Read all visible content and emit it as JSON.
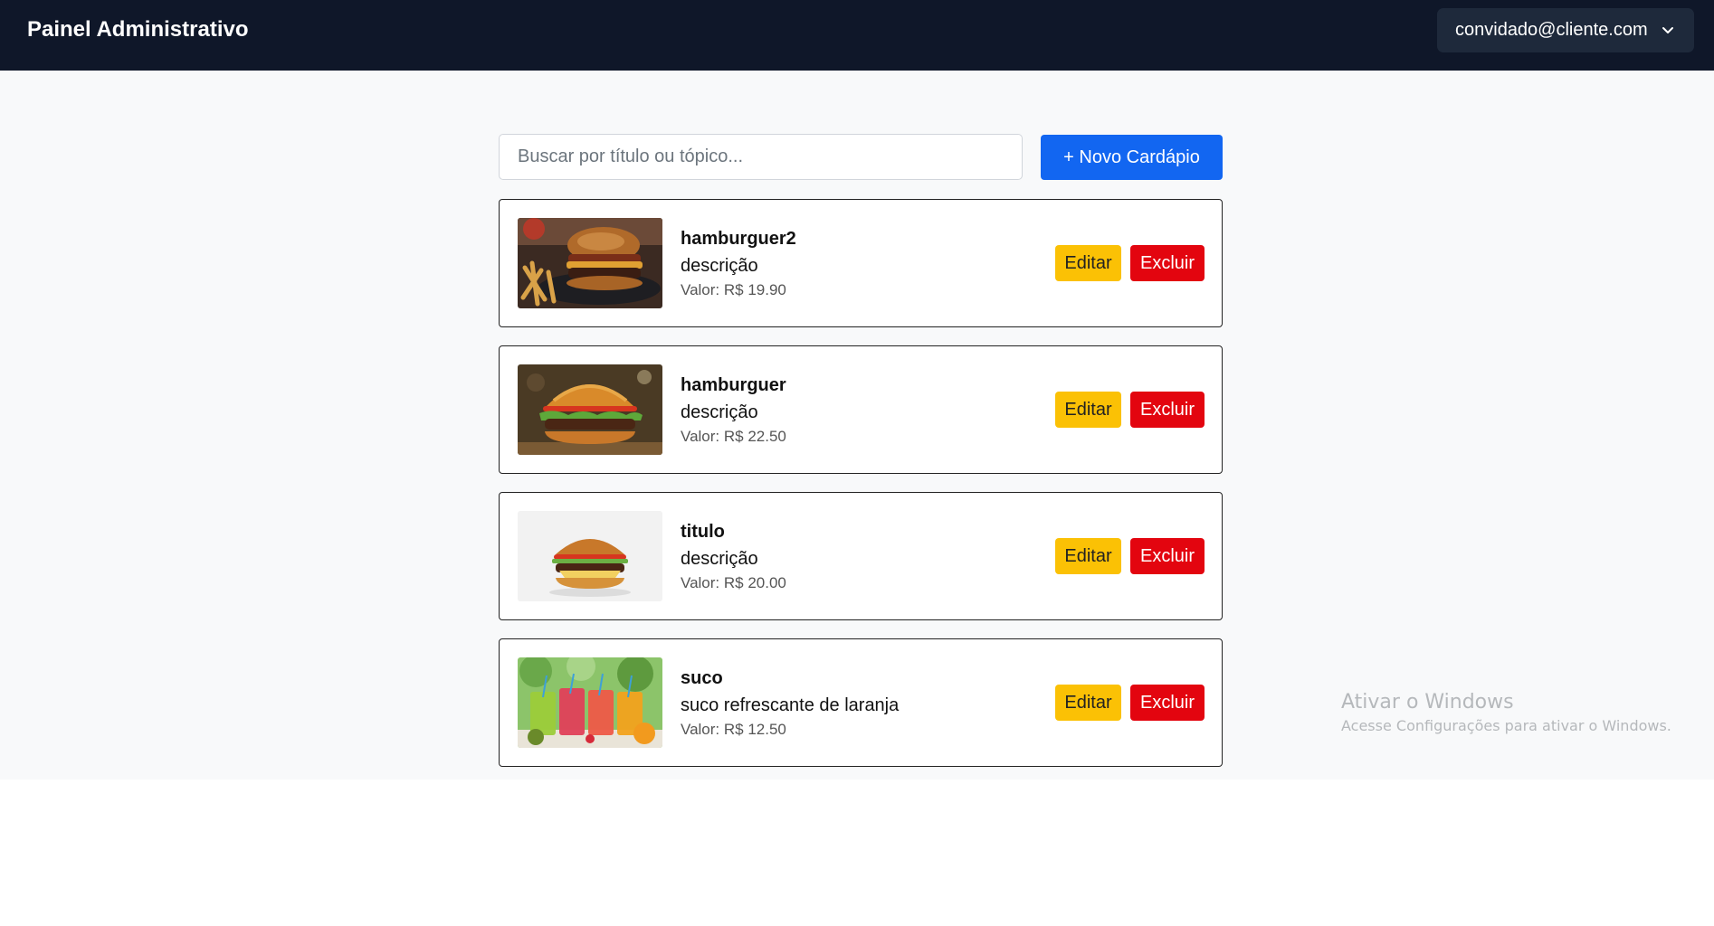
{
  "header": {
    "title": "Painel Administrativo",
    "user_email": "convidado@cliente.com"
  },
  "search": {
    "placeholder": "Buscar por título ou tópico...",
    "value": ""
  },
  "new_button_label": "+ Novo Cardápio",
  "items": [
    {
      "title": "hamburguer2",
      "description": "descrição",
      "price": "Valor: R$ 19.90",
      "image": "burger-fries-image"
    },
    {
      "title": "hamburguer",
      "description": "descrição",
      "price": "Valor: R$ 22.50",
      "image": "burger-image"
    },
    {
      "title": "titulo",
      "description": "descrição",
      "price": "Valor: R$ 20.00",
      "image": "burger-white-background-image"
    },
    {
      "title": "suco",
      "description": "suco refrescante de laranja",
      "price": "Valor: R$ 12.50",
      "image": "juice-glasses-image"
    }
  ],
  "actions": {
    "edit_label": "Editar",
    "delete_label": "Excluir"
  },
  "watermark": {
    "title": "Ativar o Windows",
    "subtitle": "Acesse Configurações para ativar o Windows."
  },
  "colors": {
    "header_bg": "#0f1729",
    "primary": "#1266f1",
    "edit": "#fbc105",
    "delete": "#e3050f",
    "page_bg": "#f8f9fa"
  }
}
